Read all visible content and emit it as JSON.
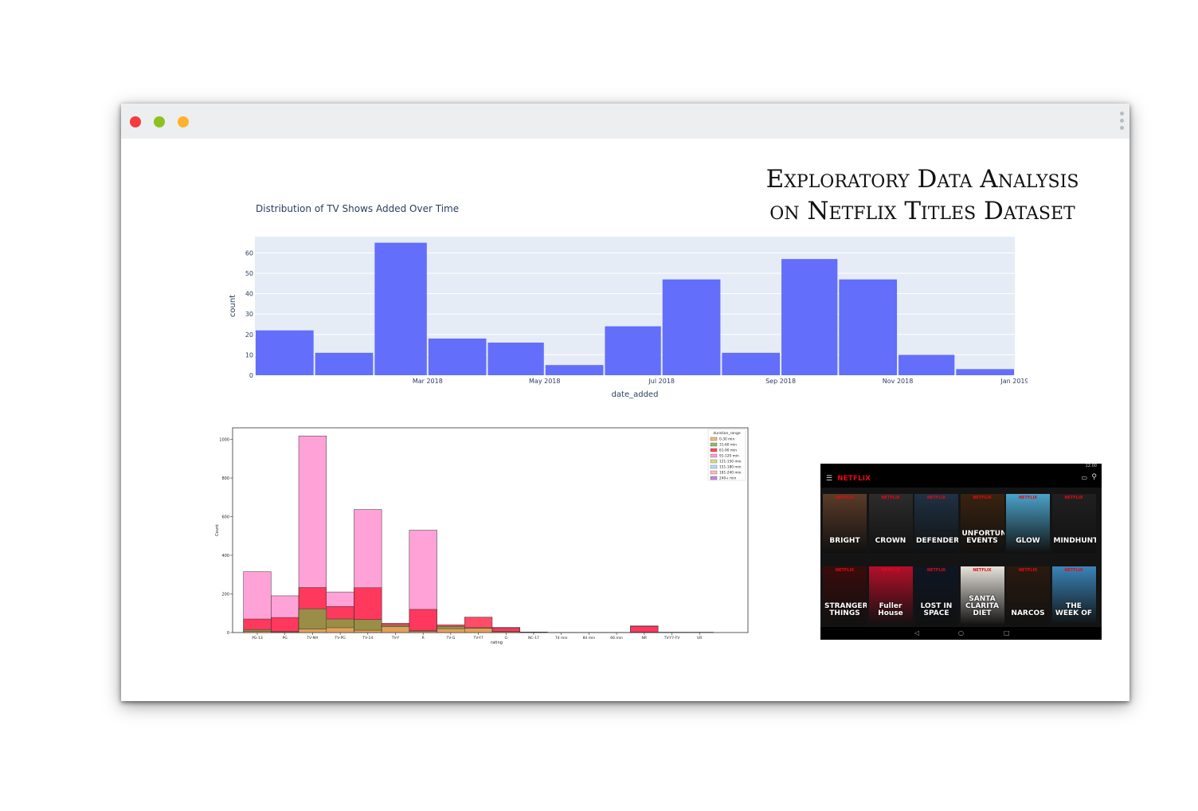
{
  "headline": {
    "line1": "Exploratory Data Analysis",
    "line2": "on Netflix Titles Dataset"
  },
  "window": {
    "controls": [
      {
        "name": "close",
        "color": "#f43c3c"
      },
      {
        "name": "minimize",
        "color": "#8cc21f"
      },
      {
        "name": "zoom",
        "color": "#ffb22e"
      }
    ]
  },
  "chart_data": [
    {
      "type": "bar",
      "title": "Distribution of TV Shows Added Over Time",
      "xlabel": "date_added",
      "ylabel": "count",
      "x_ticks": [
        "Mar 2018",
        "May 2018",
        "Jul 2018",
        "Sep 2018",
        "Nov 2018",
        "Jan 2019"
      ],
      "y_ticks": [
        0,
        10,
        20,
        30,
        40,
        50,
        60
      ],
      "ylim": [
        0,
        68
      ],
      "grid": true,
      "background": "#e5ecf6",
      "bar_color": "#636efa",
      "bins": [
        {
          "start": "2017-12-01",
          "end": "2018-01-01",
          "count": 22
        },
        {
          "start": "2018-01-01",
          "end": "2018-02-01",
          "count": 11
        },
        {
          "start": "2018-02-01",
          "end": "2018-03-01",
          "count": 65
        },
        {
          "start": "2018-03-01",
          "end": "2018-04-01",
          "count": 18
        },
        {
          "start": "2018-04-01",
          "end": "2018-05-01",
          "count": 16
        },
        {
          "start": "2018-05-01",
          "end": "2018-06-01",
          "count": 5
        },
        {
          "start": "2018-06-01",
          "end": "2018-07-01",
          "count": 24
        },
        {
          "start": "2018-07-01",
          "end": "2018-08-01",
          "count": 47
        },
        {
          "start": "2018-08-01",
          "end": "2018-09-01",
          "count": 11
        },
        {
          "start": "2018-09-01",
          "end": "2018-10-01",
          "count": 57
        },
        {
          "start": "2018-10-01",
          "end": "2018-11-01",
          "count": 47
        },
        {
          "start": "2018-11-01",
          "end": "2018-12-01",
          "count": 10
        },
        {
          "start": "2018-12-01",
          "end": "2019-01-01",
          "count": 3
        }
      ]
    },
    {
      "type": "bar",
      "stacked": true,
      "title": "",
      "xlabel": "rating",
      "ylabel": "Count",
      "ylim": [
        0,
        1060
      ],
      "y_ticks": [
        0,
        200,
        400,
        600,
        800,
        1000
      ],
      "legend_title": "duration_range",
      "legend_position": "top-right",
      "categories": [
        "PG-13",
        "PG",
        "TV-MA",
        "TV-PG",
        "TV-14",
        "TV-Y",
        "R",
        "TV-G",
        "TV-Y7",
        "G",
        "NC-17",
        "74 min",
        "84 min",
        "66 min",
        "NR",
        "TV-Y7-FV",
        "UR"
      ],
      "series": [
        {
          "name": "0-30 min",
          "color": "#f4a460",
          "values": [
            5,
            3,
            18,
            25,
            12,
            30,
            6,
            20,
            22,
            4,
            1,
            0,
            0,
            0,
            0,
            1,
            0
          ]
        },
        {
          "name": "31-60 min",
          "color": "#7ca640",
          "values": [
            10,
            2,
            105,
            45,
            55,
            8,
            4,
            12,
            3,
            2,
            0,
            0,
            0,
            0,
            2,
            0,
            0
          ]
        },
        {
          "name": "61-90 min",
          "color": "#ff1a3c",
          "values": [
            55,
            73,
            110,
            65,
            165,
            10,
            110,
            8,
            55,
            18,
            2,
            1,
            1,
            1,
            30,
            1,
            2
          ]
        },
        {
          "name": "91-120 min",
          "color": "#ff88cc",
          "values": [
            245,
            112,
            785,
            75,
            405,
            0,
            410,
            0,
            0,
            3,
            0,
            0,
            0,
            0,
            3,
            0,
            0
          ]
        },
        {
          "name": "121-150 min",
          "color": "#c8d85a",
          "values": [
            0,
            0,
            0,
            0,
            0,
            0,
            0,
            0,
            0,
            0,
            0,
            0,
            0,
            0,
            0,
            0,
            0
          ]
        },
        {
          "name": "151-180 min",
          "color": "#9fd7ff",
          "values": [
            0,
            0,
            0,
            0,
            0,
            0,
            0,
            0,
            0,
            0,
            0,
            0,
            0,
            0,
            0,
            0,
            0
          ]
        },
        {
          "name": "181-240 min",
          "color": "#ffaaaa",
          "values": [
            0,
            0,
            0,
            0,
            0,
            0,
            0,
            0,
            0,
            0,
            0,
            0,
            0,
            0,
            0,
            0,
            0
          ]
        },
        {
          "name": "240+ min",
          "color": "#b36bd6",
          "values": [
            0,
            0,
            0,
            0,
            0,
            0,
            0,
            0,
            0,
            0,
            0,
            0,
            0,
            0,
            0,
            0,
            0
          ]
        }
      ]
    }
  ],
  "netflix_screen": {
    "brand": "NETFLIX",
    "status_time": "12:00",
    "posters_row1": [
      "BRIGHT",
      "CROWN",
      "DEFENDERS",
      "UNFORTUNATE EVENTS",
      "GLOW",
      "MINDHUNTER"
    ],
    "posters_row2": [
      "STRANGER THINGS",
      "Fuller House",
      "LOST IN SPACE",
      "SANTA CLARITA DIET",
      "NARCOS",
      "THE WEEK OF"
    ],
    "poster_badge": "NETFLIX"
  }
}
